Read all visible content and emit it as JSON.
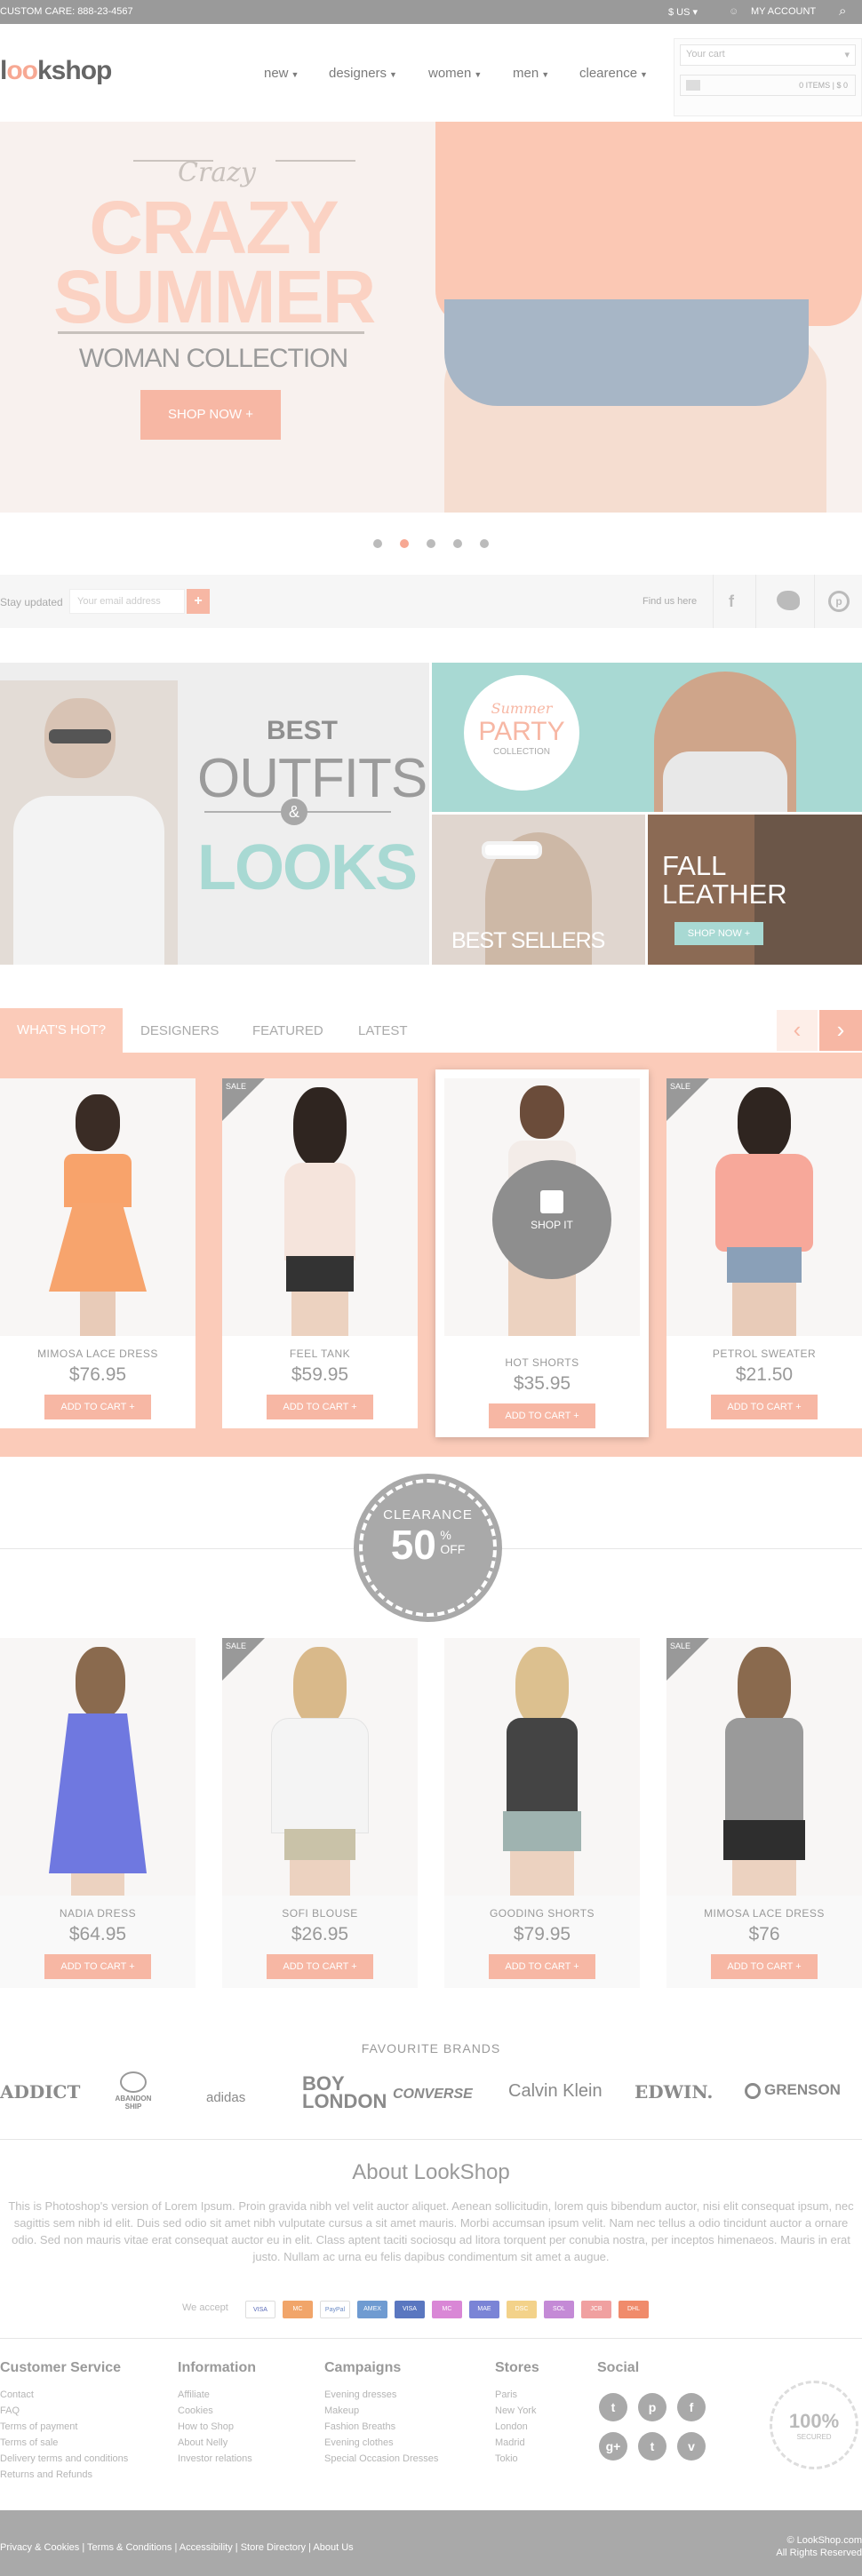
{
  "topbar": {
    "customer_care": "CUSTOM CARE:  888-23-4567",
    "currency": "$ US",
    "account": "MY ACCOUNT"
  },
  "header": {
    "logo_prefix": "l",
    "logo_oo": "oo",
    "logo_suffix": "kshop",
    "nav": [
      {
        "label": "new"
      },
      {
        "label": "designers"
      },
      {
        "label": "women"
      },
      {
        "label": "men"
      },
      {
        "label": "clearence"
      }
    ],
    "cart_placeholder": "Your cart",
    "cart_summary": "0 ITEMS  |  $ 0"
  },
  "hero": {
    "script": "Crazy",
    "line1": "CRAZY",
    "line2": "SUMMER",
    "subtitle": "WOMAN COLLECTION",
    "cta": "SHOP NOW  +"
  },
  "newsletter": {
    "label": "Stay updated",
    "placeholder": "Your email address",
    "submit": "+",
    "find_us": "Find us here"
  },
  "promo": {
    "best": "BEST",
    "outfits": "OUTFITS",
    "amp": "&",
    "looks": "LOOKS",
    "party_top": "Summer",
    "party_mid": "PARTY",
    "party_bot": "COLLECTION",
    "bestsellers": "BEST SELLERS",
    "fall1": "FALL",
    "fall2": "LEATHER",
    "fall_cta": "SHOP NOW  +"
  },
  "tabs": [
    {
      "label": "WHAT'S HOT?"
    },
    {
      "label": "DESIGNERS"
    },
    {
      "label": "FEATURED"
    },
    {
      "label": "LATEST"
    }
  ],
  "hot_products": [
    {
      "name": "MIMOSA LACE DRESS",
      "price": "$76.95",
      "button": "ADD TO CART  +",
      "sale": false
    },
    {
      "name": "FEEL TANK",
      "price": "$59.95",
      "button": "ADD TO CART  +",
      "sale": true
    },
    {
      "name": "HOT SHORTS",
      "price": "$35.95",
      "button": "ADD TO CART  +",
      "sale": false
    },
    {
      "name": "PETROL SWEATER",
      "price": "$21.50",
      "button": "ADD TO CART  +",
      "sale": true
    }
  ],
  "shop_it": "SHOP IT",
  "sale_label": "SALE",
  "clearance": {
    "word": "CLEARANCE",
    "percent": "50",
    "sign": "%",
    "off": "OFF"
  },
  "clearance_products": [
    {
      "name": "NADIA DRESS",
      "price": "$64.95",
      "button": "ADD TO CART  +",
      "sale": false
    },
    {
      "name": "SOFI BLOUSE",
      "price": "$26.95",
      "button": "ADD TO CART  +",
      "sale": true
    },
    {
      "name": "GOODING SHORTS",
      "price": "$79.95",
      "button": "ADD TO CART  +",
      "sale": false
    },
    {
      "name": "MIMOSA LACE DRESS",
      "price": "$76",
      "button": "ADD TO CART  +",
      "sale": true
    }
  ],
  "brands": {
    "title": "FAVOURITE BRANDS",
    "items": [
      "ADDICT",
      "ABANDON SHIP",
      "adidas",
      "BOY LONDON",
      "CONVERSE",
      "Calvin Klein",
      "EDWIN.",
      "GRENSON"
    ]
  },
  "about": {
    "title": "About LookShop",
    "text": "This is Photoshop's version  of Lorem Ipsum. Proin gravida nibh vel velit auctor aliquet. Aenean sollicitudin, lorem quis bibendum auctor, nisi elit consequat ipsum, nec sagittis sem nibh id elit. Duis sed odio sit amet nibh vulputate cursus a sit amet mauris. Morbi accumsan ipsum velit. Nam nec tellus a odio tincidunt auctor a ornare odio. Sed non  mauris vitae erat consequat auctor eu in elit. Class aptent taciti sociosqu ad litora torquent per conubia nostra, per inceptos himenaeos. Mauris in erat justo. Nullam ac urna eu felis dapibus condimentum sit amet a augue.",
    "we_accept": "We accept",
    "cards": [
      "VISA",
      "MC",
      "PayPal",
      "AMEX",
      "VISA",
      "MC",
      "MAE",
      "DSC",
      "SOL",
      "JCB",
      "DHL"
    ]
  },
  "footer": {
    "columns": [
      {
        "title": "Customer Service",
        "links": [
          "Contact",
          "FAQ",
          "Terms of payment",
          "Terms of sale",
          "Delivery terms and conditions",
          "Returns and Refunds"
        ]
      },
      {
        "title": "Information",
        "links": [
          "Affiliate",
          "Cookies",
          "How to Shop",
          "About Nelly",
          "Investor relations"
        ]
      },
      {
        "title": "Campaigns",
        "links": [
          "Evening dresses",
          "Makeup",
          "Fashion Breaths",
          "Evening clothes",
          "Special Occasion Dresses"
        ]
      },
      {
        "title": "Stores",
        "links": [
          "Paris",
          "New York",
          "London",
          "Madrid",
          "Tokio"
        ]
      }
    ],
    "social_title": "Social",
    "social": [
      "t",
      "p",
      "f",
      "g+",
      "t",
      "v"
    ],
    "seal_big": "100%",
    "seal_small": "SECURED"
  },
  "bottom": {
    "links": [
      "Privacy & Cookies",
      "Terms & Conditions",
      "Accessibility",
      "Store Directory",
      "About Us"
    ],
    "copy1": "© LookShop.com",
    "copy2": "All Rights Reserved"
  },
  "colors": {
    "accent": "#f7b7a4",
    "band": "#fbcbb9",
    "teal": "#a8d9d3"
  }
}
